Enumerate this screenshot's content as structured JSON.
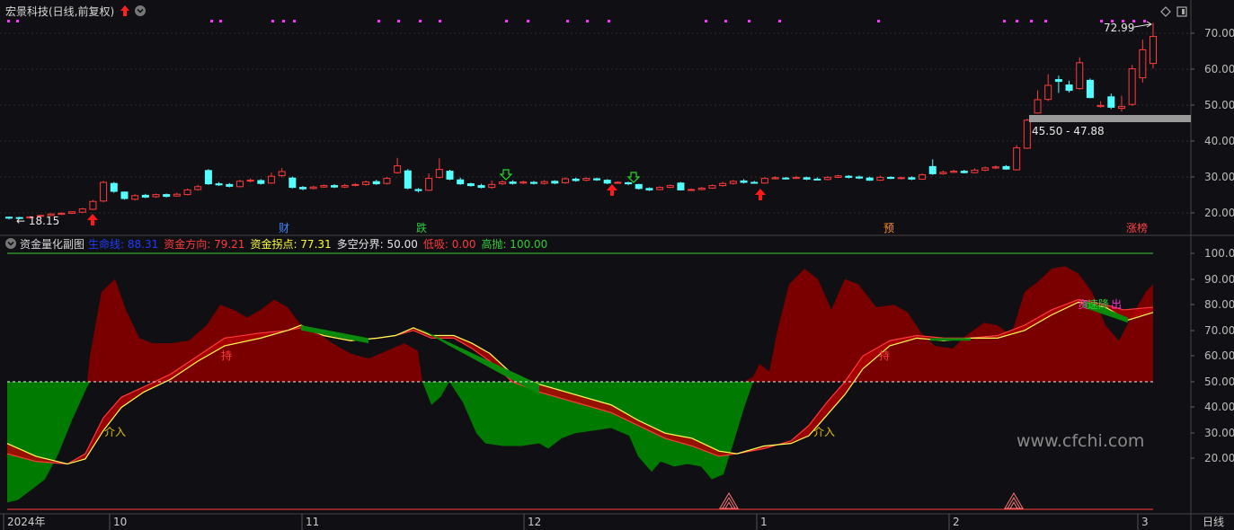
{
  "top_panel": {
    "title": "宏景科技(日线,前复权)",
    "high_label": "72.99",
    "low_label": "18.15",
    "gap_label": "45.50 - 47.88",
    "y_ticks": [
      "70.00",
      "60.00",
      "50.00",
      "40.00",
      "30.00",
      "20.00"
    ],
    "event_labels": [
      {
        "text": "财",
        "color": "#3a86ff"
      },
      {
        "text": "跌",
        "color": "#2ecc40"
      },
      {
        "text": "预",
        "color": "#ff8c1a"
      },
      {
        "text": "涨榜",
        "color": "#ff4040"
      }
    ]
  },
  "bottom_panel": {
    "title": "资金量化副图",
    "legend": [
      {
        "label": "生命线: 88.31",
        "color": "#1f3cff"
      },
      {
        "label": "资金方向: 79.21",
        "color": "#ff3b3b"
      },
      {
        "label": "资金拐点: 77.31",
        "color": "#ffff33"
      },
      {
        "label": "多空分界: 50.00",
        "color": "#e6e6e6"
      },
      {
        "label": "低吸: 0.00",
        "color": "#ff3b3b"
      },
      {
        "label": "高抛: 100.00",
        "color": "#33cc33"
      }
    ],
    "y_ticks": [
      "100.0",
      "90.00",
      "80.00",
      "70.00",
      "60.00",
      "50.00",
      "40.00",
      "30.00",
      "20.00"
    ],
    "annotations": [
      {
        "text": "介入",
        "color": "#e0c000"
      },
      {
        "text": "持",
        "color": "#ff3b3b"
      },
      {
        "text": "介入",
        "color": "#e0c000"
      },
      {
        "text": "持",
        "color": "#ff3b3b"
      },
      {
        "text": "资",
        "color": "#ff33cc"
      },
      {
        "text": "速降",
        "color": "#33cc33"
      },
      {
        "text": "出",
        "color": "#ff33cc"
      }
    ],
    "watermark": "www.cfchi.com"
  },
  "x_axis": {
    "labels": [
      "2024年",
      "10",
      "11",
      "12",
      "1",
      "2",
      "3"
    ],
    "period": "日线"
  },
  "colors": {
    "up": "#ff3b3b",
    "down": "#54ffff",
    "bg": "#101014",
    "grid": "#3a3a3a",
    "fill_red": "#7a0000",
    "fill_green": "#007a00"
  }
}
